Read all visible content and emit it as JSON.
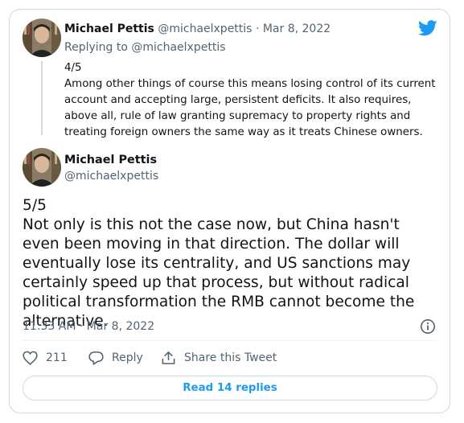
{
  "parent_tweet": {
    "author_name": "Michael Pettis",
    "author_handle": "@michaelxpettis",
    "separator": "·",
    "date": "Mar 8, 2022",
    "replying_to": "Replying to @michaelxpettis",
    "text": "4/5\nAmong other things of course this means losing control of its current account and accepting large, persistent deficits. It also requires, above all, rule of law granting supremacy to property rights and treating foreign owners the same way as it treats Chinese owners."
  },
  "main_tweet": {
    "author_name": "Michael Pettis",
    "author_handle": "@michaelxpettis",
    "text": "5/5\nNot only is this not the case now, but China hasn't even been moving in that direction. The dollar will eventually lose its centrality, and US  sanctions may certainly speed up that process, but without radical political transformation the RMB cannot become the alternative.",
    "timestamp": "11:33 AM · Mar 8, 2022"
  },
  "actions": {
    "like_count": "211",
    "reply_label": "Reply",
    "share_label": "Share this Tweet"
  },
  "read_replies_label": "Read 14 replies",
  "colors": {
    "twitter_blue": "#1d9bf0",
    "muted_text": "#536471",
    "border": "#cfd9de"
  },
  "icons": [
    "twitter-logo-icon",
    "info-icon",
    "heart-icon",
    "reply-bubble-icon",
    "share-icon"
  ]
}
